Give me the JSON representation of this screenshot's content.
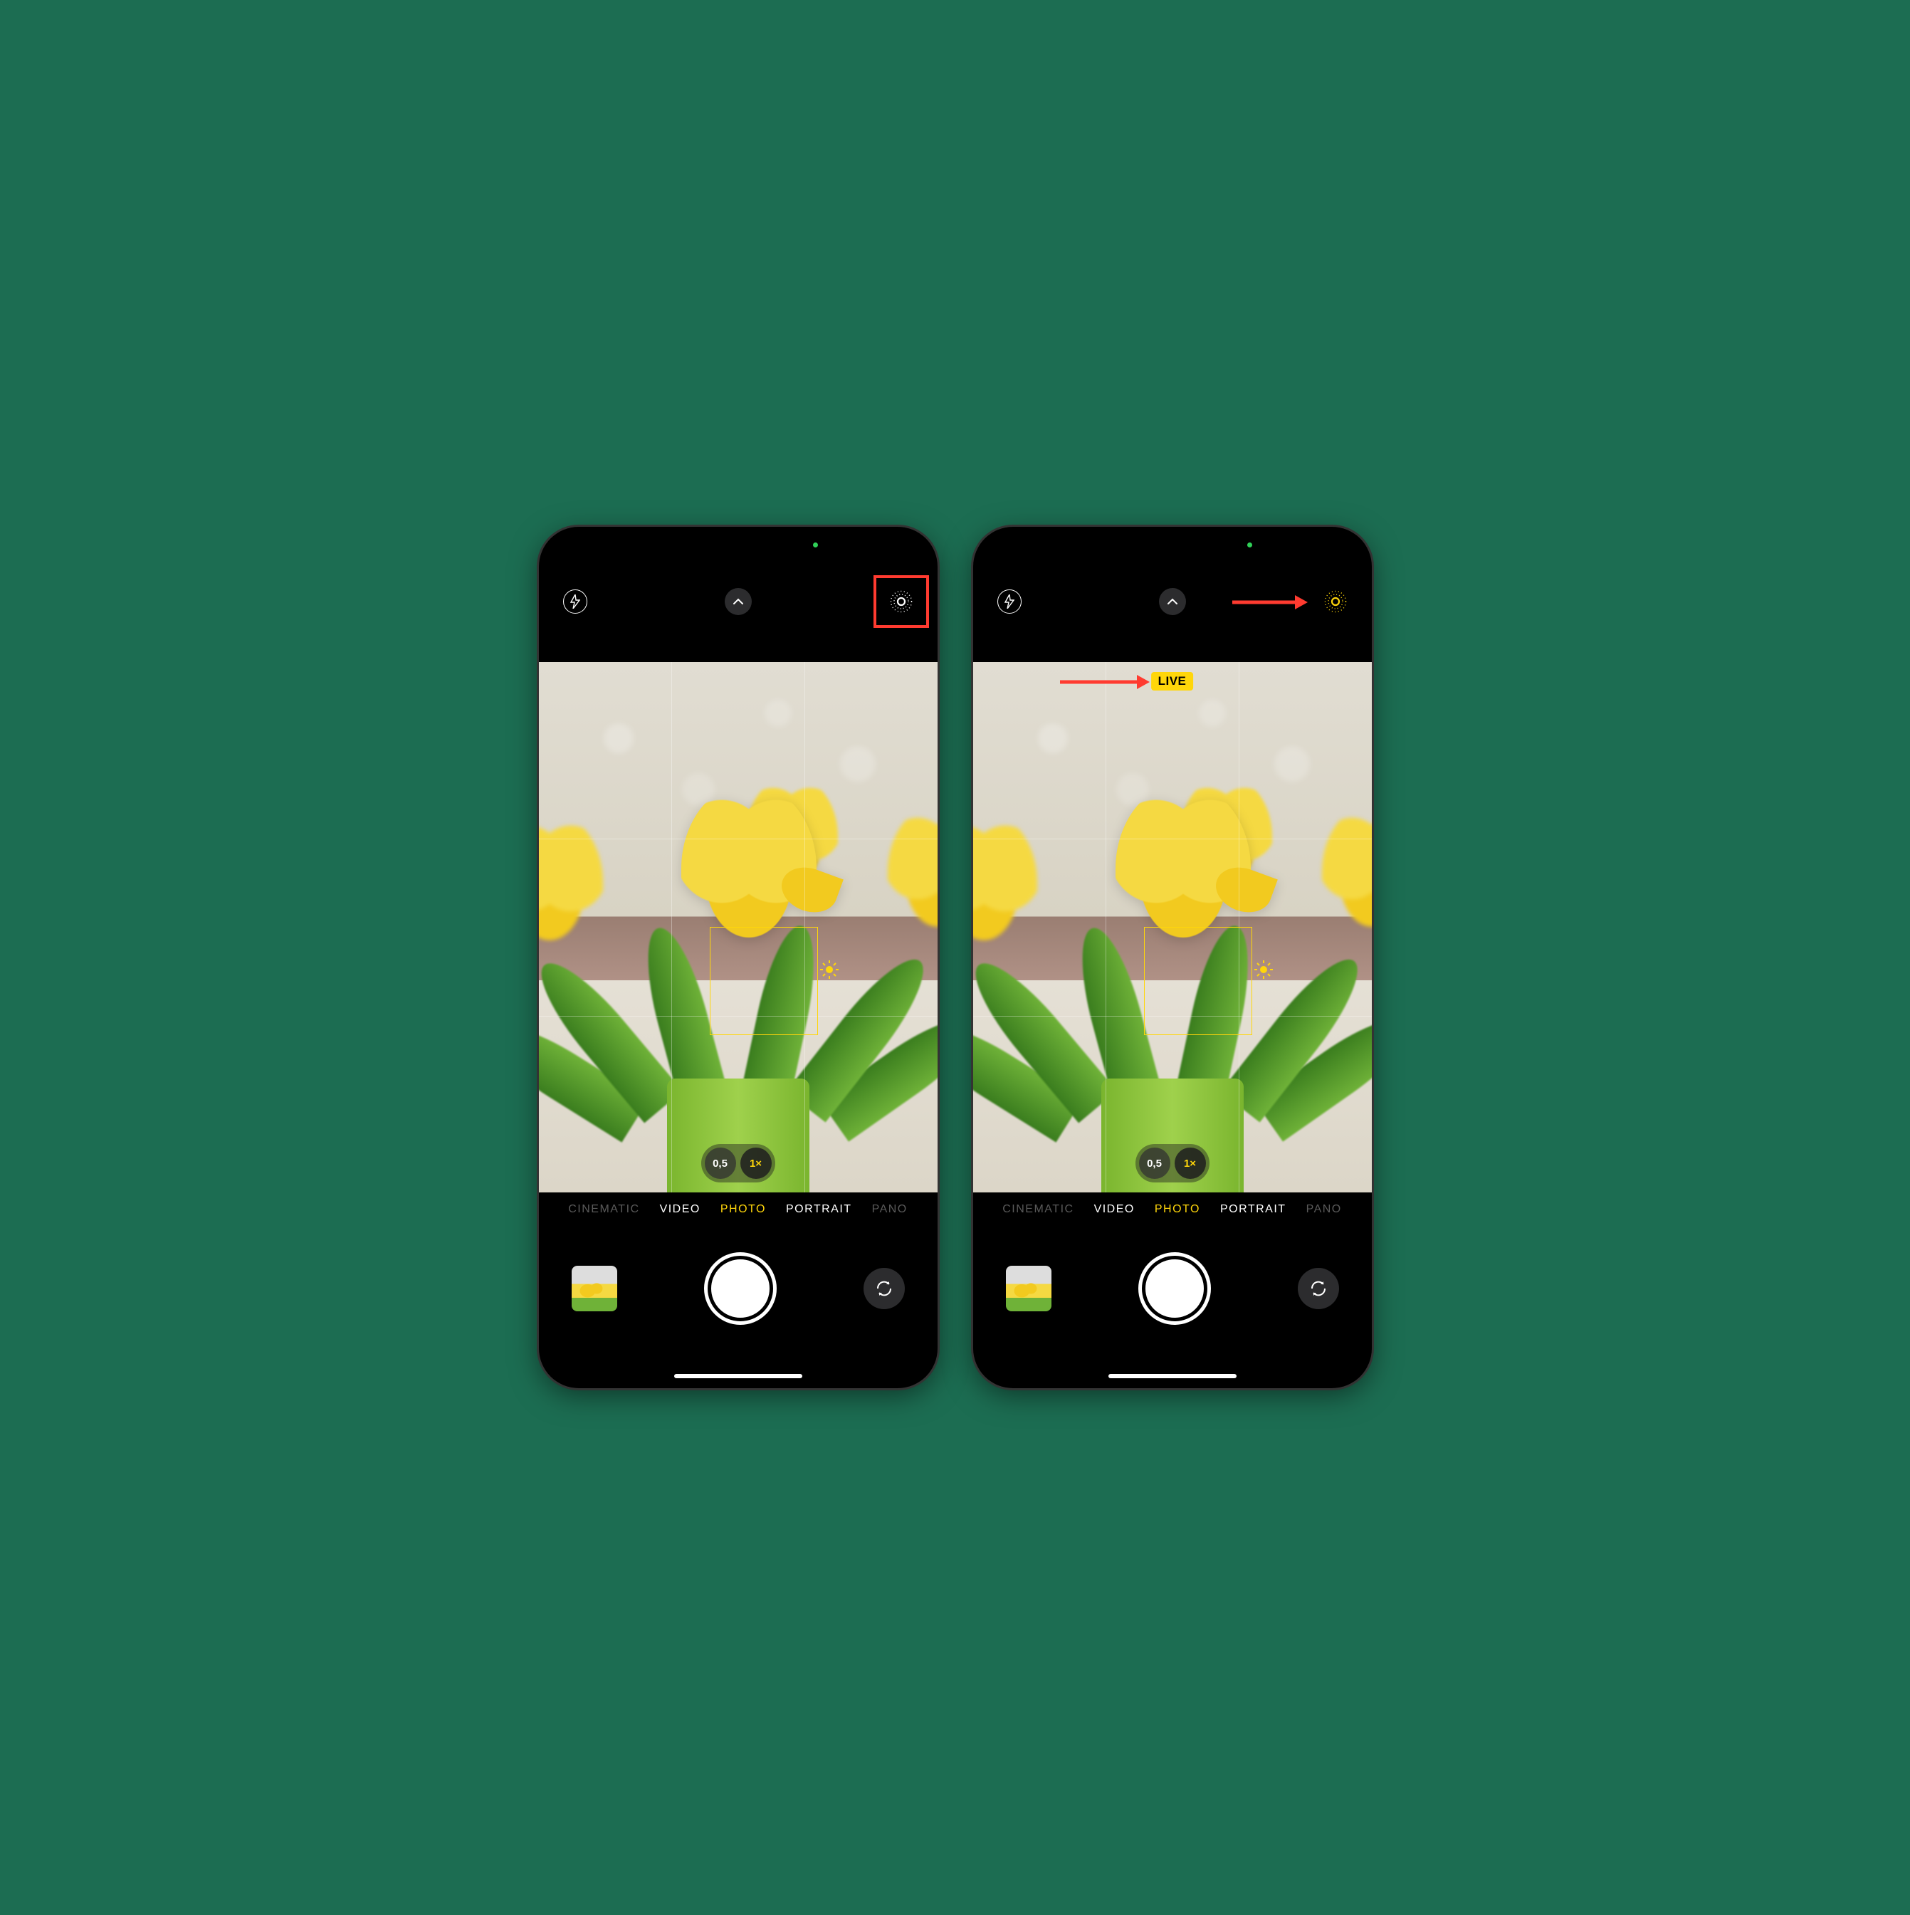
{
  "colors": {
    "accent_yellow": "#ffd60a",
    "annotation_red": "#ff3b30",
    "status_green": "#30d158"
  },
  "left_phone": {
    "top": {
      "flash_state": "auto",
      "live_photo_state": "off",
      "live_highlighted": true
    },
    "zoom": {
      "options": [
        "0,5",
        "1×"
      ],
      "active": "1×"
    },
    "modes": [
      "CINEMATIC",
      "VIDEO",
      "PHOTO",
      "PORTRAIT",
      "PANO"
    ],
    "active_mode": "PHOTO",
    "live_badge_visible": false
  },
  "right_phone": {
    "top": {
      "flash_state": "auto",
      "live_photo_state": "on",
      "live_annotated_arrow": true
    },
    "zoom": {
      "options": [
        "0,5",
        "1×"
      ],
      "active": "1×"
    },
    "modes": [
      "CINEMATIC",
      "VIDEO",
      "PHOTO",
      "PORTRAIT",
      "PANO"
    ],
    "active_mode": "PHOTO",
    "live_badge_visible": true,
    "live_badge_text": "LIVE"
  },
  "icons": {
    "flash": "flash-icon",
    "chevron_up": "chevron-up-icon",
    "live_photo": "live-photo-icon",
    "camera_flip": "camera-flip-icon",
    "sun": "exposure-sun-icon"
  }
}
